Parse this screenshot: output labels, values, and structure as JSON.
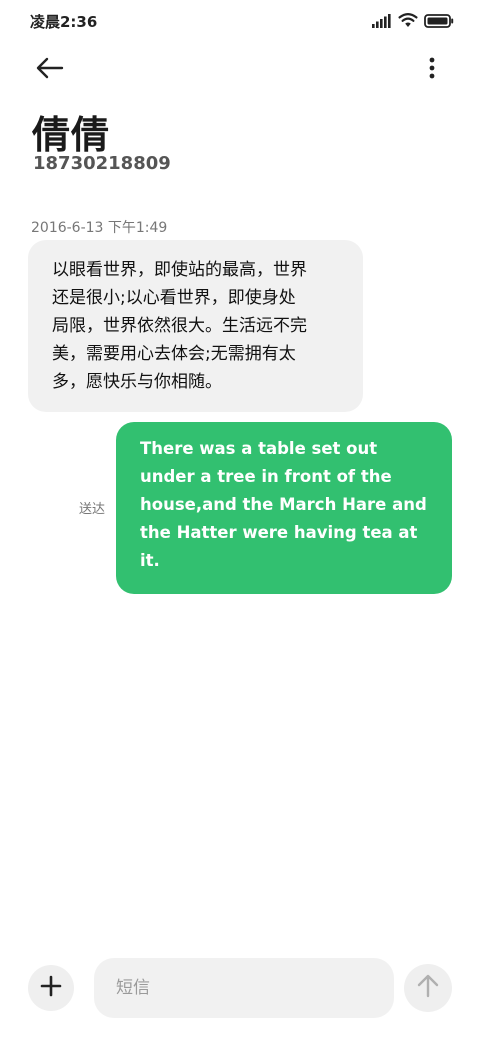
{
  "status_bar": {
    "time": "凌晨2:36",
    "icons": [
      "signal-icon",
      "wifi-icon",
      "battery-icon"
    ]
  },
  "nav": {
    "back_icon": "back-arrow-icon",
    "more_icon": "more-vertical-icon"
  },
  "contact": {
    "name": "倩倩",
    "number": "18730218809"
  },
  "conversation": {
    "timestamp": "2016-6-13 下午1:49",
    "messages": [
      {
        "direction": "incoming",
        "lines": [
          "以眼看世界，即使站的最高，世界",
          "还是很小;以心看世界，即使身处",
          "局限，世界依然很大。生活远不完",
          "美，需要用心去体会;无需拥有太",
          "多，愿快乐与你相随。"
        ]
      },
      {
        "direction": "outgoing",
        "lines": [
          "There was a table set out",
          "under a tree in front of the",
          "house,and the March Hare and",
          "the Hatter were having tea at",
          "it."
        ],
        "status": "送达"
      }
    ]
  },
  "composer": {
    "placeholder": "短信",
    "add_icon": "plus-icon",
    "send_icon": "arrow-up-icon"
  },
  "colors": {
    "outgoing_bubble": "#32c070",
    "incoming_bubble": "#f1f1f1",
    "background": "#ffffff"
  }
}
